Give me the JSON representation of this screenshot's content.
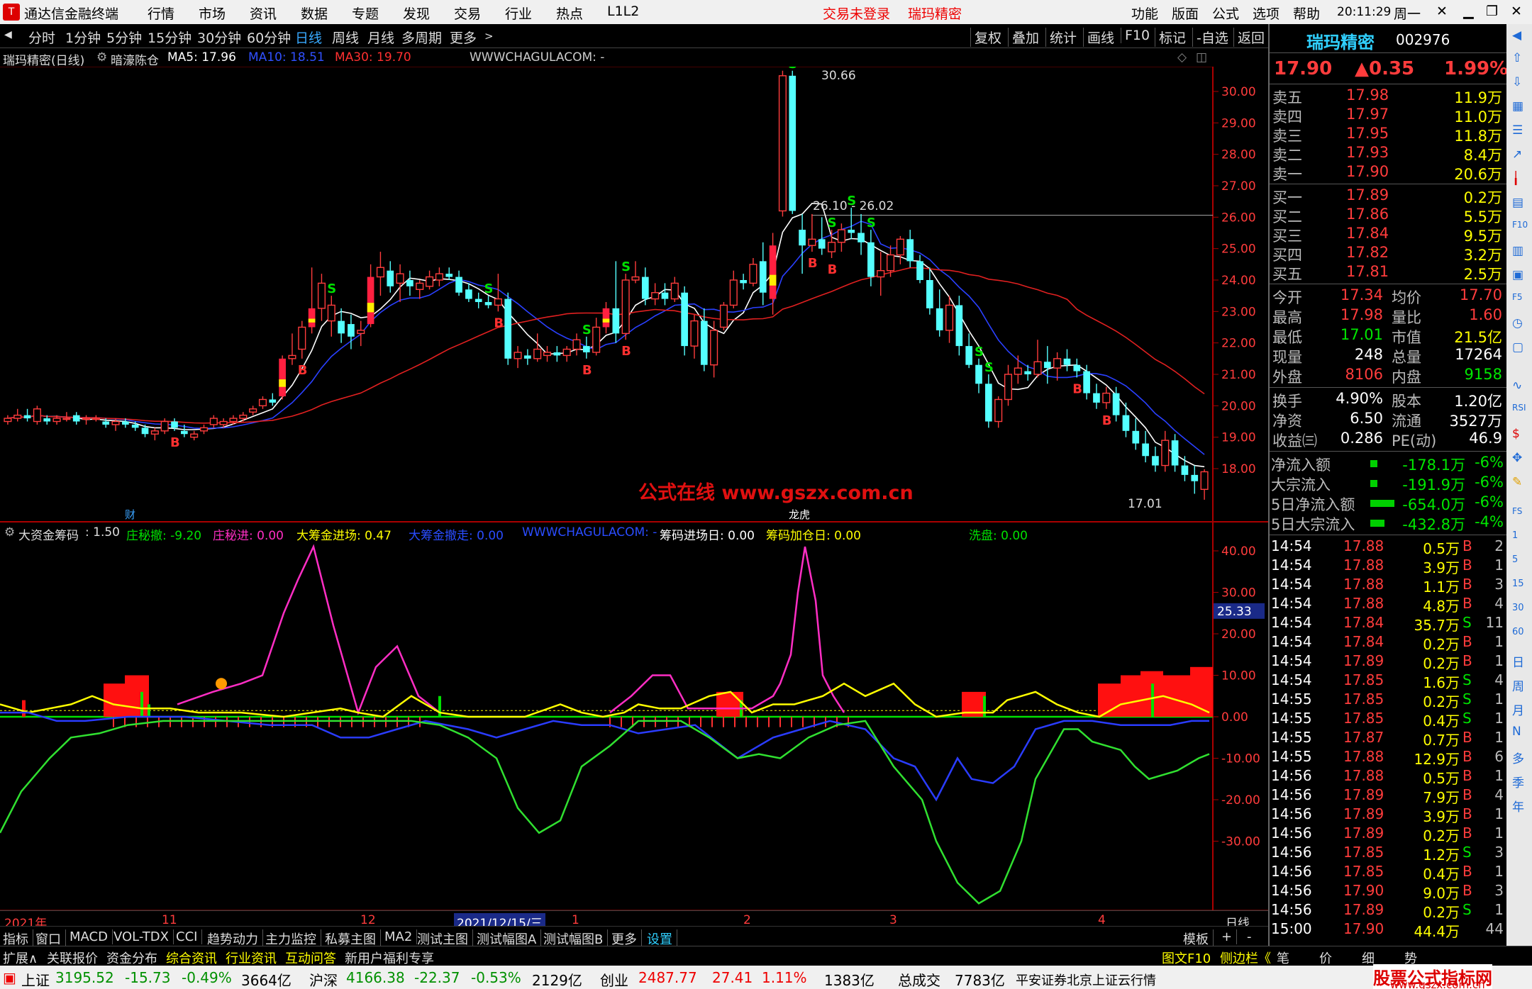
{
  "menubar": {
    "app_title": "通达信金融终端",
    "items": [
      "行情",
      "市场",
      "资讯",
      "数据",
      "专题",
      "发现",
      "交易",
      "行业",
      "热点",
      "L1L2"
    ],
    "trade_status": "交易未登录",
    "stock_name": "瑞玛精密",
    "right_items": [
      "功能",
      "版面",
      "公式",
      "选项",
      "帮助"
    ],
    "time": "20:11:29",
    "weekday": "周一"
  },
  "toolbar": {
    "periods": [
      "分时",
      "1分钟",
      "5分钟",
      "15分钟",
      "30分钟",
      "60分钟",
      "日线",
      "周线",
      "月线",
      "多周期",
      "更多"
    ],
    "active": "日线",
    "right": [
      "复权",
      "叠加",
      "统计",
      "画线",
      "F10",
      "标记",
      "-自选",
      "返回"
    ]
  },
  "chart_info": {
    "title": "瑞玛精密(日线)",
    "scheme": "暗濠陈仓",
    "ma5": "MA5: 17.96",
    "ma10": "MA10: 18.51",
    "ma30": "MA30: 19.70",
    "url": "WWWCHAGULACOM: -"
  },
  "annotations": {
    "high": "30.66",
    "range": "26.10 - 26.02",
    "low": "17.01",
    "cai": "财",
    "longhu": "龙虎",
    "watermark": "公式在线  www.gszx.com.cn"
  },
  "indicator": {
    "name": "大资金筹码",
    "v1": ": 1.50",
    "zhuang_san": "庄秘撤: -9.20",
    "zhuang_jin": "庄秘进: 0.00",
    "dachou_jin": "大筹金进场: 0.47",
    "dachou_zou": "大筹金撤走: 0.00",
    "url": "WWWCHAGULACOM: -",
    "jinchang": "筹码进场日: 0.00",
    "jiacang": "筹码加仓日: 0.00",
    "xipan": "洗盘: 0.00",
    "cur": "25.33"
  },
  "price_axis": [
    "30.00",
    "29.00",
    "28.00",
    "27.00",
    "26.00",
    "25.00",
    "24.00",
    "23.00",
    "22.00",
    "21.00",
    "20.00",
    "19.00",
    "18.00"
  ],
  "ind_axis": [
    "40.00",
    "30.00",
    "20.00",
    "10.00",
    "0.00",
    "-10.00",
    "-20.00",
    "-30.00"
  ],
  "date_axis": {
    "items": [
      "2021年",
      "11",
      "12",
      "2021/12/15/三",
      "1",
      "2",
      "3",
      "4"
    ],
    "period": "日线"
  },
  "bottom_tabs": [
    "指标",
    "窗口",
    "MACD",
    "VOL-TDX",
    "CCI",
    "趋势动力",
    "主力监控",
    "私募主图",
    "MA2",
    "测试主图",
    "测试幅图A",
    "测试幅图B",
    "更多",
    "设置"
  ],
  "bottom_tabs_right": [
    "模板",
    "+",
    "-"
  ],
  "bottom_links": [
    "扩展∧",
    "关联报价",
    "资金分布",
    "综合资讯",
    "行业资讯",
    "互动问答",
    "新用户福利专享"
  ],
  "bottom_links_right": [
    "图文F10",
    "侧边栏《",
    "笔",
    "价",
    "细",
    "势"
  ],
  "quote": {
    "name": "瑞玛精密",
    "code": "002976",
    "price": "17.90",
    "change": "▲0.35",
    "pct": "1.99%",
    "asks": [
      [
        "卖五",
        "17.98",
        "11.9万"
      ],
      [
        "卖四",
        "17.97",
        "11.0万"
      ],
      [
        "卖三",
        "17.95",
        "11.8万"
      ],
      [
        "卖二",
        "17.93",
        "8.4万"
      ],
      [
        "卖一",
        "17.90",
        "20.6万"
      ]
    ],
    "bids": [
      [
        "买一",
        "17.89",
        "0.2万"
      ],
      [
        "买二",
        "17.86",
        "5.5万"
      ],
      [
        "买三",
        "17.84",
        "9.5万"
      ],
      [
        "买四",
        "17.82",
        "3.2万"
      ],
      [
        "买五",
        "17.81",
        "2.5万"
      ]
    ],
    "stats": [
      [
        "今开",
        "17.34",
        "均价",
        "17.70"
      ],
      [
        "最高",
        "17.98",
        "量比",
        "1.60"
      ],
      [
        "最低",
        "17.01",
        "市值",
        "21.5亿"
      ],
      [
        "现量",
        "248",
        "总量",
        "17264"
      ],
      [
        "外盘",
        "8106",
        "内盘",
        "9158"
      ]
    ],
    "stats2": [
      [
        "换手",
        "4.90%",
        "股本",
        "1.20亿"
      ],
      [
        "净资",
        "6.50",
        "流通",
        "3527万"
      ],
      [
        "收益㈢",
        "0.286",
        "PE(动)",
        "46.9"
      ]
    ],
    "flows": [
      [
        "净流入额",
        "-178.1万",
        "-6%"
      ],
      [
        "大宗流入",
        "-191.9万",
        "-6%"
      ],
      [
        "5日净流入额",
        "-654.0万",
        "-6%"
      ],
      [
        "5日大宗流入",
        "-432.8万",
        "-4%"
      ]
    ],
    "ticks": [
      [
        "14:54",
        "17.88",
        "0.5万",
        "B",
        "2"
      ],
      [
        "14:54",
        "17.88",
        "3.9万",
        "B",
        "1"
      ],
      [
        "14:54",
        "17.88",
        "1.1万",
        "B",
        "3"
      ],
      [
        "14:54",
        "17.88",
        "4.8万",
        "B",
        "4"
      ],
      [
        "14:54",
        "17.84",
        "35.7万",
        "S",
        "11"
      ],
      [
        "14:54",
        "17.84",
        "0.2万",
        "B",
        "1"
      ],
      [
        "14:54",
        "17.89",
        "0.2万",
        "B",
        "1"
      ],
      [
        "14:54",
        "17.85",
        "1.6万",
        "S",
        "4"
      ],
      [
        "14:55",
        "17.85",
        "0.2万",
        "S",
        "1"
      ],
      [
        "14:55",
        "17.85",
        "0.4万",
        "S",
        "1"
      ],
      [
        "14:55",
        "17.87",
        "0.7万",
        "B",
        "1"
      ],
      [
        "14:55",
        "17.88",
        "12.9万",
        "B",
        "6"
      ],
      [
        "14:56",
        "17.88",
        "0.5万",
        "B",
        "1"
      ],
      [
        "14:56",
        "17.89",
        "7.9万",
        "B",
        "4"
      ],
      [
        "14:56",
        "17.89",
        "3.9万",
        "B",
        "1"
      ],
      [
        "14:56",
        "17.89",
        "0.2万",
        "B",
        "1"
      ],
      [
        "14:56",
        "17.85",
        "1.2万",
        "S",
        "3"
      ],
      [
        "14:56",
        "17.85",
        "0.4万",
        "B",
        "1"
      ],
      [
        "14:56",
        "17.90",
        "9.0万",
        "B",
        "3"
      ],
      [
        "14:56",
        "17.89",
        "0.2万",
        "S",
        "1"
      ],
      [
        "15:00",
        "17.90",
        "44.4万",
        "",
        "44"
      ]
    ]
  },
  "sidebar": [
    "日",
    "周",
    "月",
    "N",
    "多",
    "季",
    "年"
  ],
  "status": {
    "sh_name": "上证",
    "sh": "3195.52",
    "sh_chg": "-15.73",
    "sh_pct": "-0.49%",
    "sh_amt": "3664亿",
    "hs_name": "沪深",
    "hs": "4166.38",
    "hs_chg": "-22.37",
    "hs_pct": "-0.53%",
    "hs_amt": "2129亿",
    "cy_name": "创业",
    "cy": "2487.77",
    "cy_chg": "27.41",
    "cy_pct": "1.11%",
    "cy_amt": "1383亿",
    "total_label": "总成交",
    "total": "7783亿",
    "broker": "平安证券北京上证云行情",
    "site": "股票公式指标网",
    "site_url": "www.gszx.com.cn"
  },
  "chart_data": {
    "type": "candlestick",
    "ohlc": [
      [
        19.5,
        19.7,
        19.4,
        19.6
      ],
      [
        19.6,
        19.9,
        19.5,
        19.7
      ],
      [
        19.7,
        19.9,
        19.5,
        19.6
      ],
      [
        19.5,
        20.0,
        19.4,
        19.9
      ],
      [
        19.6,
        19.7,
        19.4,
        19.5
      ],
      [
        19.5,
        19.7,
        19.4,
        19.6
      ],
      [
        19.6,
        19.8,
        19.5,
        19.6
      ],
      [
        19.7,
        19.8,
        19.4,
        19.5
      ],
      [
        19.6,
        19.7,
        19.4,
        19.6
      ],
      [
        19.6,
        19.7,
        19.5,
        19.6
      ],
      [
        19.5,
        19.6,
        19.3,
        19.4
      ],
      [
        19.4,
        19.6,
        19.2,
        19.5
      ],
      [
        19.5,
        19.6,
        19.3,
        19.4
      ],
      [
        19.4,
        19.5,
        19.2,
        19.3
      ],
      [
        19.3,
        19.4,
        19.0,
        19.1
      ],
      [
        19.1,
        19.3,
        18.9,
        19.2
      ],
      [
        19.2,
        19.6,
        19.1,
        19.5
      ],
      [
        19.5,
        19.6,
        19.2,
        19.3
      ],
      [
        19.2,
        19.4,
        19.0,
        19.1
      ],
      [
        19.0,
        19.2,
        18.9,
        19.1
      ],
      [
        19.2,
        19.4,
        19.1,
        19.3
      ],
      [
        19.4,
        19.7,
        19.3,
        19.6
      ],
      [
        19.4,
        19.6,
        19.3,
        19.5
      ],
      [
        19.5,
        19.7,
        19.4,
        19.6
      ],
      [
        19.6,
        19.8,
        19.5,
        19.7
      ],
      [
        19.8,
        20.0,
        19.7,
        19.9
      ],
      [
        20.0,
        20.3,
        19.9,
        20.2
      ],
      [
        20.2,
        20.4,
        20.0,
        20.1
      ],
      [
        20.3,
        21.6,
        20.2,
        21.5
      ],
      [
        21.5,
        22.3,
        21.3,
        21.6
      ],
      [
        21.8,
        22.7,
        21.5,
        22.5
      ],
      [
        22.5,
        24.4,
        22.3,
        23.1
      ],
      [
        23.1,
        24.2,
        22.7,
        23.9
      ],
      [
        22.7,
        23.5,
        22.2,
        23.2
      ],
      [
        22.7,
        23.1,
        22.0,
        22.3
      ],
      [
        22.6,
        22.9,
        21.8,
        22.2
      ],
      [
        22.3,
        22.7,
        21.9,
        22.4
      ],
      [
        22.6,
        24.5,
        22.5,
        24.1
      ],
      [
        24.1,
        24.9,
        23.5,
        24.4
      ],
      [
        24.3,
        24.6,
        23.6,
        23.8
      ],
      [
        23.9,
        24.5,
        23.3,
        24.2
      ],
      [
        24.0,
        24.3,
        23.5,
        23.8
      ],
      [
        23.7,
        24.0,
        23.4,
        23.9
      ],
      [
        23.8,
        24.3,
        23.7,
        24.1
      ],
      [
        24.0,
        24.4,
        23.8,
        24.2
      ],
      [
        24.2,
        24.4,
        24.0,
        24.1
      ],
      [
        24.1,
        24.3,
        23.5,
        23.6
      ],
      [
        23.7,
        23.9,
        23.3,
        23.4
      ],
      [
        23.4,
        23.6,
        23.1,
        23.3
      ],
      [
        23.3,
        23.5,
        23.1,
        23.2
      ],
      [
        23.2,
        24.2,
        23.0,
        23.4
      ],
      [
        23.4,
        23.6,
        21.3,
        21.5
      ],
      [
        21.5,
        21.9,
        21.2,
        21.7
      ],
      [
        21.6,
        21.8,
        21.3,
        21.5
      ],
      [
        21.5,
        22.3,
        21.4,
        21.8
      ],
      [
        21.6,
        21.9,
        21.4,
        21.7
      ],
      [
        21.7,
        21.9,
        21.4,
        21.6
      ],
      [
        21.6,
        21.9,
        21.4,
        21.8
      ],
      [
        21.8,
        22.3,
        21.6,
        22.1
      ],
      [
        21.9,
        22.2,
        21.5,
        21.7
      ],
      [
        21.7,
        22.8,
        21.6,
        22.5
      ],
      [
        22.5,
        23.3,
        22.3,
        23.1
      ],
      [
        23.1,
        24.6,
        22.0,
        22.3
      ],
      [
        22.3,
        24.2,
        22.1,
        24.0
      ],
      [
        24.0,
        24.6,
        23.9,
        24.1
      ],
      [
        24.1,
        24.4,
        23.2,
        23.4
      ],
      [
        23.4,
        23.9,
        23.2,
        23.6
      ],
      [
        23.6,
        23.9,
        23.2,
        23.4
      ],
      [
        23.4,
        24.1,
        23.3,
        23.9
      ],
      [
        23.6,
        23.8,
        21.6,
        21.9
      ],
      [
        21.9,
        22.9,
        21.5,
        22.7
      ],
      [
        22.7,
        23.1,
        21.1,
        21.3
      ],
      [
        21.3,
        22.7,
        20.9,
        22.4
      ],
      [
        22.5,
        23.3,
        22.4,
        23.2
      ],
      [
        23.2,
        24.3,
        23.1,
        24.0
      ],
      [
        24.0,
        24.2,
        23.7,
        23.9
      ],
      [
        23.9,
        24.7,
        23.8,
        24.5
      ],
      [
        24.6,
        25.2,
        23.2,
        23.6
      ],
      [
        23.4,
        25.5,
        22.9,
        25.1
      ],
      [
        26.2,
        30.66,
        26.02,
        30.5
      ],
      [
        30.5,
        30.66,
        26.1,
        26.2
      ],
      [
        25.6,
        26.1,
        24.2,
        25.1
      ],
      [
        25.1,
        26.1,
        24.9,
        25.3
      ],
      [
        25.3,
        26.0,
        24.8,
        25.0
      ],
      [
        24.9,
        25.6,
        24.7,
        25.2
      ],
      [
        25.2,
        25.8,
        24.9,
        25.6
      ],
      [
        25.6,
        26.3,
        25.3,
        25.5
      ],
      [
        25.5,
        26.1,
        24.8,
        25.2
      ],
      [
        25.2,
        25.6,
        23.8,
        24.1
      ],
      [
        24.1,
        24.9,
        23.5,
        24.3
      ],
      [
        24.3,
        25.1,
        24.1,
        24.8
      ],
      [
        24.8,
        25.4,
        24.5,
        25.3
      ],
      [
        25.3,
        25.6,
        24.4,
        24.6
      ],
      [
        24.6,
        24.8,
        23.9,
        24.0
      ],
      [
        24.0,
        24.4,
        22.9,
        23.1
      ],
      [
        23.1,
        23.7,
        22.2,
        22.4
      ],
      [
        22.4,
        23.5,
        22.0,
        23.2
      ],
      [
        23.2,
        23.5,
        21.6,
        21.9
      ],
      [
        21.9,
        22.3,
        21.2,
        21.3
      ],
      [
        21.3,
        21.5,
        20.4,
        20.7
      ],
      [
        20.7,
        21.0,
        19.3,
        19.5
      ],
      [
        19.5,
        20.3,
        19.3,
        20.2
      ],
      [
        20.2,
        21.3,
        20.0,
        21.0
      ],
      [
        21.0,
        21.6,
        20.7,
        21.2
      ],
      [
        21.1,
        21.3,
        20.8,
        21.0
      ],
      [
        21.0,
        22.1,
        20.9,
        21.4
      ],
      [
        21.4,
        21.9,
        20.7,
        21.2
      ],
      [
        21.2,
        21.7,
        20.8,
        21.5
      ],
      [
        21.5,
        21.8,
        21.1,
        21.3
      ],
      [
        21.3,
        21.5,
        20.9,
        21.1
      ],
      [
        21.1,
        21.3,
        20.2,
        20.4
      ],
      [
        20.4,
        20.7,
        19.9,
        20.1
      ],
      [
        20.1,
        20.6,
        19.9,
        20.4
      ],
      [
        20.4,
        20.6,
        19.5,
        19.7
      ],
      [
        19.7,
        20.1,
        19.0,
        19.2
      ],
      [
        19.2,
        19.6,
        18.6,
        18.8
      ],
      [
        18.8,
        19.2,
        18.2,
        18.4
      ],
      [
        18.4,
        18.7,
        17.9,
        18.1
      ],
      [
        18.1,
        19.2,
        17.9,
        18.9
      ],
      [
        18.9,
        19.1,
        17.9,
        18.1
      ],
      [
        18.1,
        18.4,
        17.6,
        17.8
      ],
      [
        17.8,
        18.1,
        17.2,
        17.6
      ],
      [
        17.34,
        17.98,
        17.01,
        17.9
      ]
    ]
  }
}
